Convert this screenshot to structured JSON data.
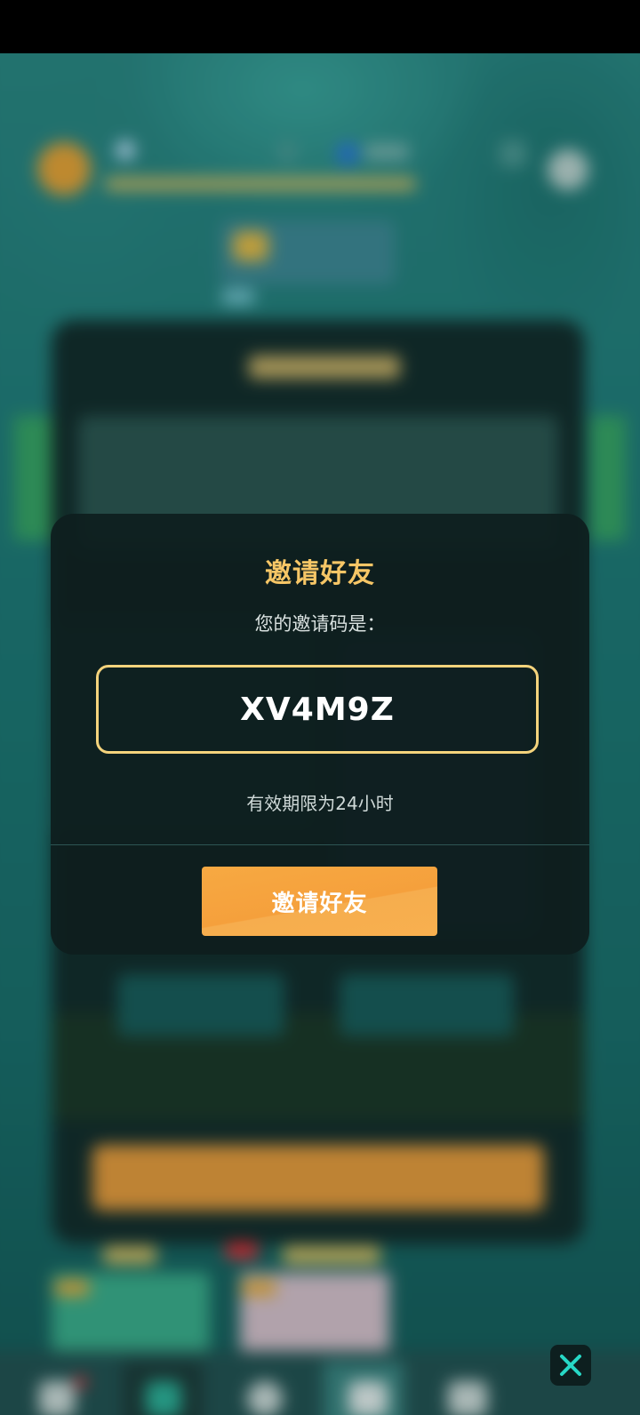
{
  "dialog": {
    "title": "邀请好友",
    "code_label": "您的邀请码是：",
    "invite_code": "XV4M9Z",
    "validity_text": "有效期限为24小时",
    "invite_button_label": "邀请好友"
  },
  "close_button": {
    "icon": "close-icon"
  },
  "colors": {
    "accent_gold": "#f6c666",
    "button_orange": "#f5a03c",
    "close_icon": "#27d8c6"
  }
}
